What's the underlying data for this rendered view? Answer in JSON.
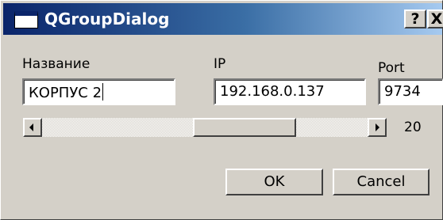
{
  "window": {
    "title": "QGroupDialog",
    "help_label": "?",
    "close_label": "X"
  },
  "fields": {
    "name": {
      "label": "Название",
      "value": "КОРПУС 2"
    },
    "ip": {
      "label": "IP",
      "value": "192.168.0.137"
    },
    "port": {
      "label": "Port",
      "value": "9734"
    }
  },
  "slider": {
    "value": "20",
    "position_fraction": 0.68
  },
  "buttons": {
    "ok_label": "OK",
    "cancel_label": "Cancel"
  },
  "colors": {
    "titlebar_start": "#0a246a",
    "titlebar_end": "#a6caf0",
    "dialog_bg": "#d4d0c8"
  },
  "icons": [
    "window-icon",
    "help-icon",
    "close-icon",
    "scroll-left-arrow-icon",
    "scroll-right-arrow-icon"
  ]
}
